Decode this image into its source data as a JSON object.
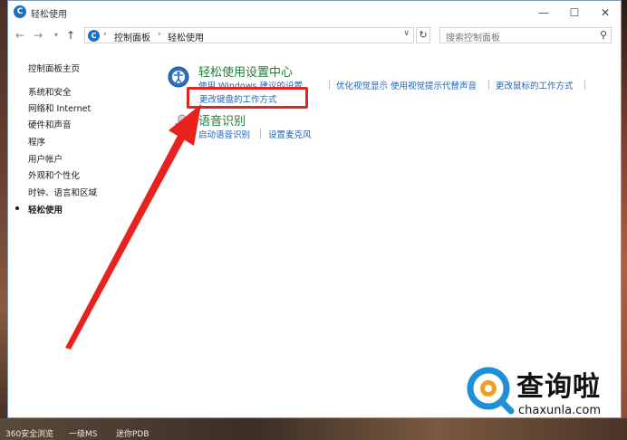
{
  "window": {
    "title": "轻松使用",
    "controls": {
      "minimize": "—",
      "maximize": "☐",
      "close": "✕"
    }
  },
  "addressbar": {
    "crumbs": [
      "控制面板",
      "轻松使用"
    ],
    "search_placeholder": "搜索控制面板"
  },
  "sidebar": {
    "home": "控制面板主页",
    "items": [
      "系统和安全",
      "网络和 Internet",
      "硬件和声音",
      "程序",
      "用户帐户",
      "外观和个性化",
      "时钟、语言和区域",
      "轻松使用"
    ],
    "selected_index": 7
  },
  "categories": [
    {
      "title": "轻松使用设置中心",
      "icon": "ease-of-access-icon",
      "links": [
        "使用 Windows 建议的设置",
        "优化视觉显示",
        "使用视觉提示代替声音",
        "更改鼠标的工作方式",
        "更改键盘的工作方式"
      ]
    },
    {
      "title": "语音识别",
      "icon": "microphone-icon",
      "links": [
        "启动语音识别",
        "设置麦克风"
      ]
    }
  ],
  "watermark": {
    "text": "查询啦",
    "url": "chaxunla.com"
  },
  "taskbar": {
    "items": [
      "360安全浏览",
      "一级MS",
      "迷你PDB"
    ]
  },
  "colors": {
    "link": "#1f63b5",
    "category": "#1e7e34",
    "highlight": "#e8231f",
    "arrow": "#e8231f"
  }
}
